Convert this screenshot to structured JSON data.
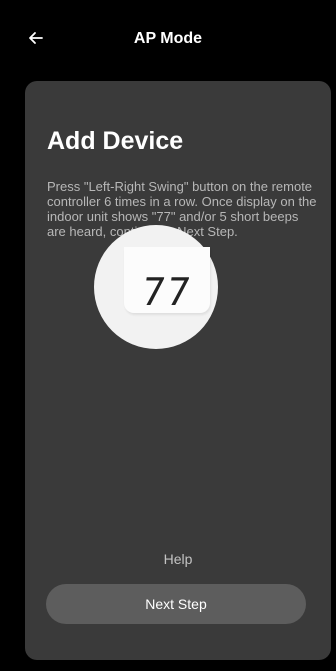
{
  "header": {
    "title": "AP Mode",
    "back_icon": "arrow-left-icon"
  },
  "card": {
    "title": "Add Device",
    "instructions": "Press \"Left-Right Swing\" button on the remote controller 6 times in a row. Once display on the indoor unit shows \"77\" and/or 5 short beeps are heard, continue to Next Step.",
    "display_value": "77",
    "help_label": "Help",
    "next_button_label": "Next Step"
  },
  "colors": {
    "background": "#000000",
    "card": "#3a3a3a",
    "button": "#5d5d5d",
    "text_secondary": "#b7b7b7"
  }
}
